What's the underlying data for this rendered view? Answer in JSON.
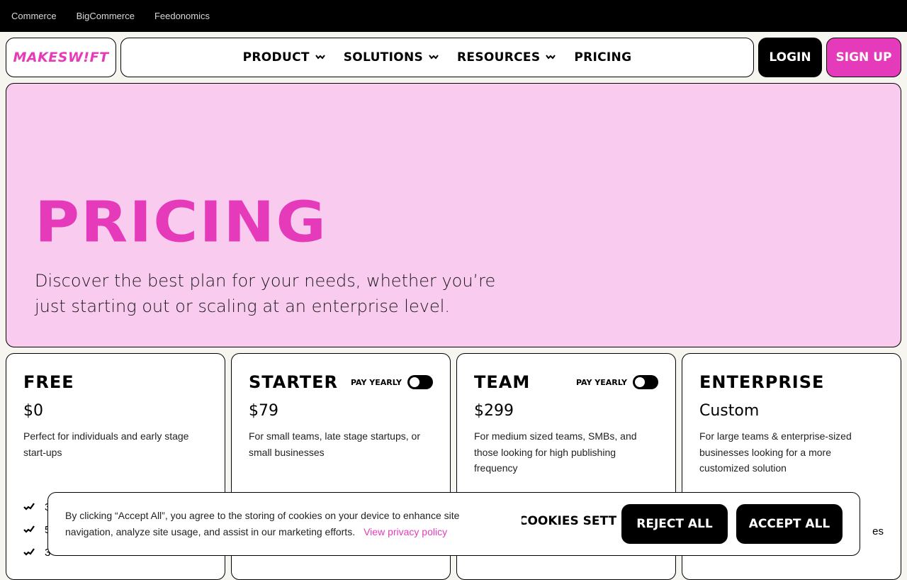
{
  "topbar": {
    "links": [
      "Commerce",
      "BigCommerce",
      "Feedonomics"
    ]
  },
  "header": {
    "logo": "MAKESW!FT",
    "nav": [
      "PRODUCT",
      "SOLUTIONS",
      "RESOURCES",
      "PRICING"
    ],
    "login": "LOGIN",
    "signup": "SIGN UP"
  },
  "hero": {
    "title": "PRICING",
    "subtitle": "Discover the best plan for your needs, whether you’re just starting out or scaling at an enterprise level."
  },
  "plans": [
    {
      "name": "FREE",
      "price": "$0",
      "desc": "Perfect for individuals and early stage start-ups",
      "features": [
        "3",
        "5",
        "3"
      ]
    },
    {
      "name": "STARTER",
      "price": "$79",
      "desc": "For small teams, late stage startups, or small businesses",
      "toggle": "PAY YEARLY"
    },
    {
      "name": "TEAM",
      "price": "$299",
      "desc": "For medium sized teams, SMBs, and those looking for high publishing frequency",
      "toggle": "PAY YEARLY"
    },
    {
      "name": "ENTERPRISE",
      "price": "Custom",
      "desc": "For large teams & enterprise-sized businesses looking for a more customized solution",
      "features": [
        "es"
      ]
    }
  ],
  "cookie": {
    "text": "By clicking “Accept All”, you agree to the storing of cookies on your device to enhance site navigation, analyze site usage, and assist in our marketing efforts.",
    "privacy_link": "View privacy policy",
    "settings": "COOKIES SETTINGS",
    "reject": "REJECT ALL",
    "accept": "ACCEPT ALL"
  },
  "colors": {
    "brand_pink": "#e53bba",
    "hero_bg": "#f9cbef"
  }
}
